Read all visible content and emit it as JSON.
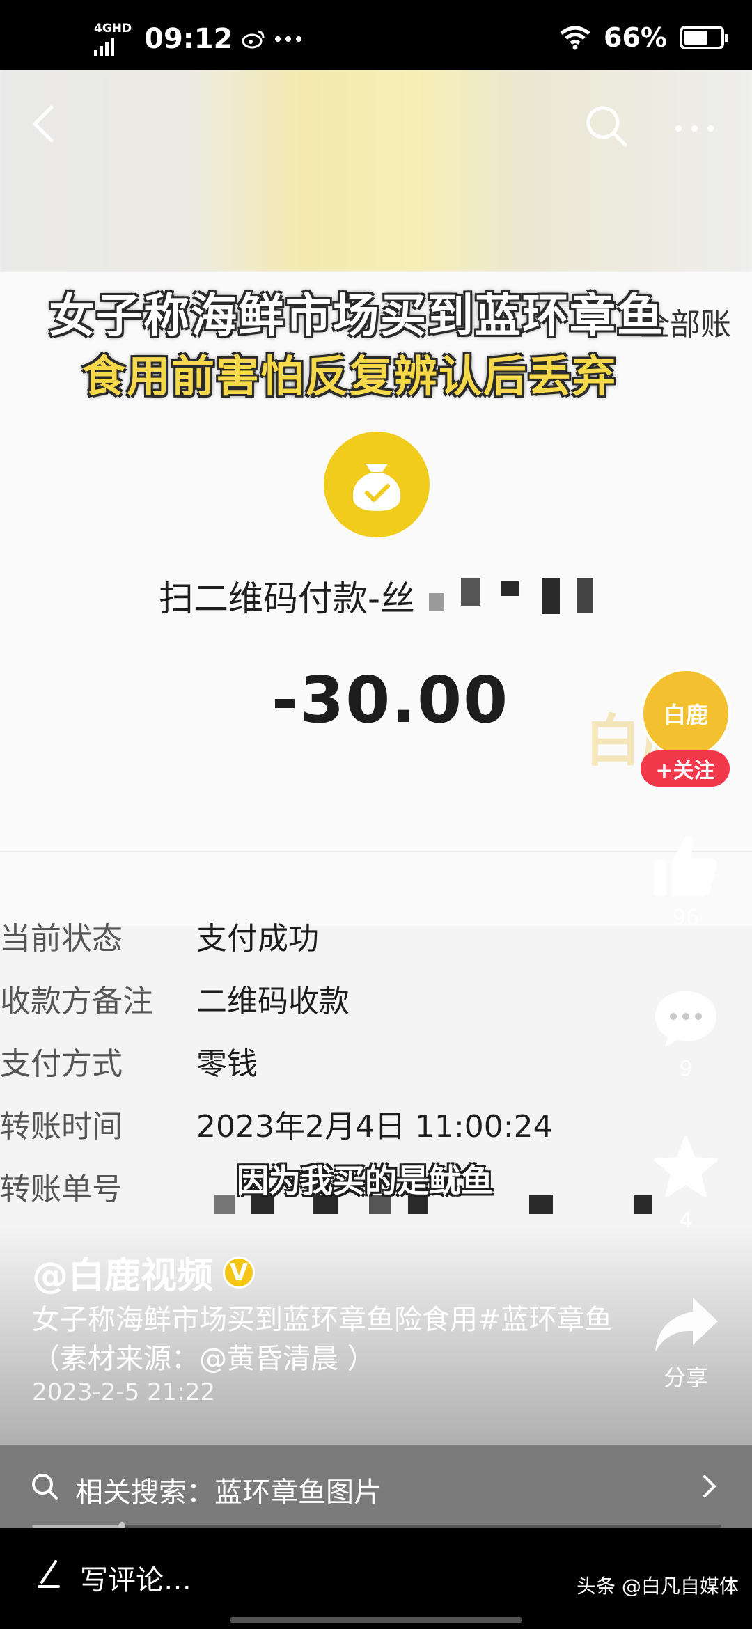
{
  "status_bar": {
    "network": "4GHD",
    "time": "09:12",
    "battery_pct": "66%",
    "battery_level": 0.66
  },
  "video": {
    "caption_line1": "女子称海鲜市场买到蓝环章鱼",
    "caption_line2": "食用前害怕反复辨认后丢弃",
    "behind_text": "全部账",
    "payment_title": "扫二维码付款-丝",
    "amount": "-30.00",
    "watermark": "白鹿",
    "details": [
      {
        "label": "当前状态",
        "value": "支付成功"
      },
      {
        "label": "收款方备注",
        "value": "二维码收款"
      },
      {
        "label": "支付方式",
        "value": "零钱"
      },
      {
        "label": "转账时间",
        "value": "2023年2月4日 11:00:24"
      },
      {
        "label": "转账单号",
        "value": ""
      }
    ],
    "subtitle": "因为我买的是鱿鱼"
  },
  "post": {
    "author": "@白鹿视频",
    "verified_badge": "V",
    "description": "女子称海鲜市场买到蓝环章鱼险食用#蓝环章鱼（素材来源：@黄昏清晨 ）",
    "date": "2023-2-5  21:22"
  },
  "rail": {
    "avatar_text": "白鹿",
    "follow_label": "+关注",
    "likes": "96",
    "comments": "9",
    "favorites": "4",
    "share_label": "分享"
  },
  "related_search": {
    "text": "相关搜索：蓝环章鱼图片"
  },
  "comment_bar": {
    "placeholder": "写评论…",
    "source": "头条 @白凡自媒体"
  },
  "progress": {
    "value": 0.13
  },
  "colors": {
    "accent_yellow": "#f2cc1d",
    "follow_red": "#f2394b",
    "caption_yellow": "#f6d94a"
  }
}
